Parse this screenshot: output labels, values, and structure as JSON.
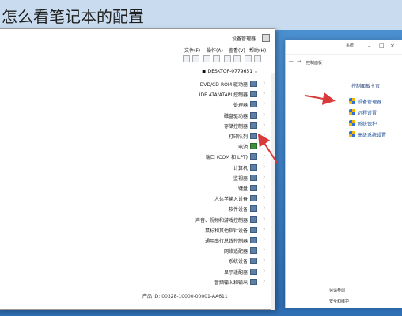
{
  "page_title": "怎么看笔记本的配置",
  "device_manager": {
    "title": "设备管理器",
    "menu": [
      "文件(F)",
      "操作(A)",
      "查看(V)",
      "帮助(H)"
    ],
    "root": "DESKTOP-0779651",
    "tree": [
      "DVD/CD-ROM 驱动器",
      "IDE ATA/ATAPI 控制器",
      "处理器",
      "磁盘驱动器",
      "存储控制器",
      "打印队列",
      "电池",
      "端口 (COM 和 LPT)",
      "计算机",
      "监视器",
      "键盘",
      "人体学输入设备",
      "软件设备",
      "声音、视频和游戏控制器",
      "鼠标和其他指针设备",
      "通用串行总线控制器",
      "网络适配器",
      "系统设备",
      "显示适配器",
      "音频输入和输出"
    ],
    "status_text": "产品 ID: 00328-10000-00001-AA611"
  },
  "system_window": {
    "title": "系统",
    "breadcrumb": "控制面板",
    "home_link": "控制面板主页",
    "links": [
      "设备管理器",
      "远程设置",
      "系统保护",
      "高级系统设置"
    ],
    "see_also": "另请参阅",
    "security": "安全和维护"
  },
  "colors": {
    "arrow": "#d93a3a",
    "link": "#1a4e98",
    "desktop": "#3a7dc3"
  }
}
